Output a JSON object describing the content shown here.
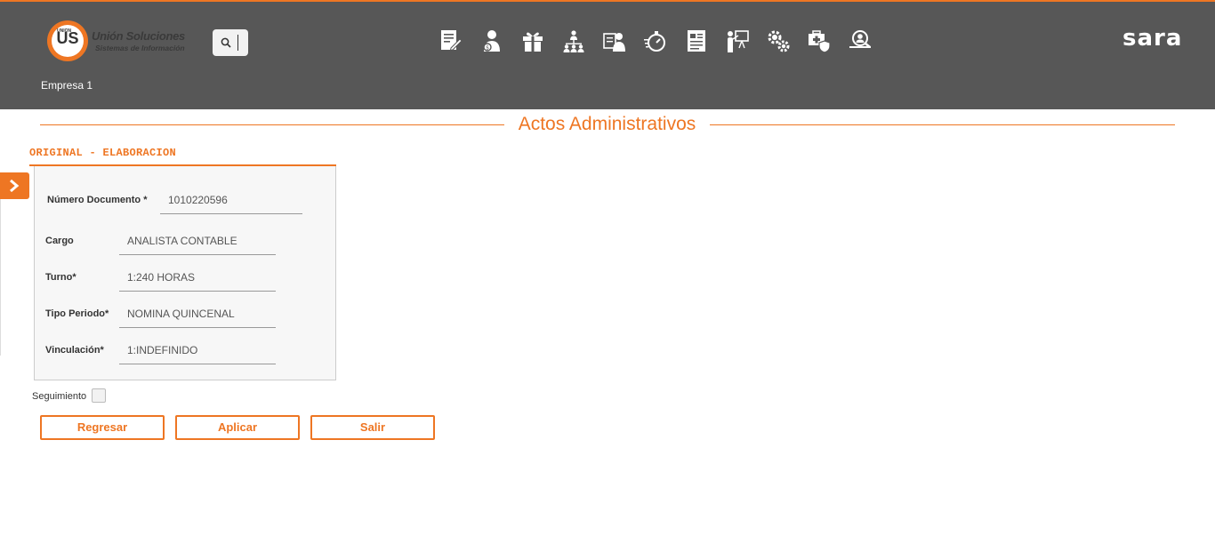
{
  "header": {
    "logo": {
      "union": "UNION",
      "us": "US",
      "title": "Unión Soluciones",
      "subtitle": "Sistemas de Información"
    },
    "search_icon": "search-icon",
    "company": "Empresa 1",
    "nav_icons": [
      "document-edit-icon",
      "user-money-icon",
      "gift-icon",
      "org-chart-icon",
      "user-id-card-icon",
      "stopwatch-icon",
      "report-document-icon",
      "presenter-board-icon",
      "gears-icon",
      "medical-kit-shield-icon",
      "user-search-icon"
    ],
    "brand": "sara"
  },
  "page": {
    "title": "Actos Administrativos"
  },
  "side_toggle_icon": "chevron-right-icon",
  "section": {
    "title": "ORIGINAL - ELABORACION"
  },
  "form": {
    "numero_documento": {
      "label": "Número Documento",
      "required_mark": "*",
      "value": "1010220596"
    },
    "cargo": {
      "label": "Cargo",
      "value": "ANALISTA CONTABLE"
    },
    "turno": {
      "label": "Turno*",
      "value": "1:240 HORAS"
    },
    "tipo_periodo": {
      "label": "Tipo Periodo*",
      "value": "NOMINA QUINCENAL"
    },
    "vinculacion": {
      "label": "Vinculación*",
      "value": "1:INDEFINIDO"
    }
  },
  "seguimiento": {
    "label": "Seguimiento",
    "checked": false
  },
  "buttons": {
    "regresar": "Regresar",
    "aplicar": "Aplicar",
    "salir": "Salir"
  },
  "colors": {
    "accent": "#ee7623",
    "header_bg": "#575757"
  }
}
